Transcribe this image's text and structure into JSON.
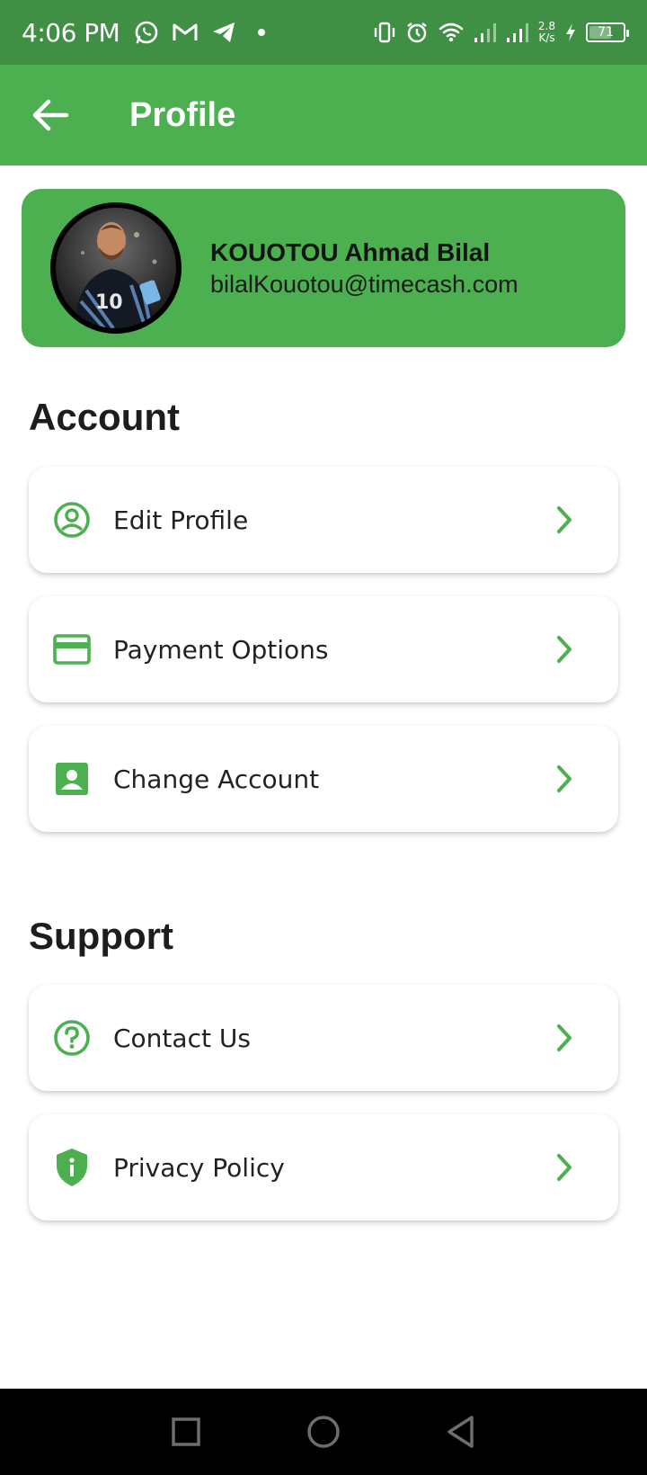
{
  "status_bar": {
    "time": "4:06 PM",
    "speed_value": "2.8",
    "speed_unit": "K/s",
    "battery": "71",
    "battery_level": 0.71,
    "icons": [
      "whatsapp-icon",
      "gmail-icon",
      "telegram-icon",
      "notification-dot",
      "vibrate-icon",
      "alarm-icon",
      "wifi-icon",
      "signal-icon",
      "signal-icon",
      "charging-icon",
      "battery-icon"
    ]
  },
  "app_bar": {
    "title": "Profile",
    "back_icon": "arrow-left-icon"
  },
  "profile": {
    "name": "KOUOTOU Ahmad Bilal",
    "email": "bilalKouotou@timecash.com"
  },
  "account": {
    "title": "Account",
    "items": [
      {
        "label": "Edit Profile",
        "icon": "account-circle-icon"
      },
      {
        "label": "Payment Options",
        "icon": "credit-card-icon"
      },
      {
        "label": "Change Account",
        "icon": "account-box-icon"
      }
    ]
  },
  "support": {
    "title": "Support",
    "items": [
      {
        "label": "Contact Us",
        "icon": "help-circle-icon"
      },
      {
        "label": "Privacy Policy",
        "icon": "shield-info-icon"
      }
    ]
  },
  "nav_bar": {
    "icons": [
      "recents-square-icon",
      "home-circle-icon",
      "back-triangle-icon"
    ]
  },
  "colors": {
    "primary": "#4caf50",
    "status_bar": "#3f8f44",
    "icon_green": "#4caf50",
    "text_dark": "#1f1f1f"
  }
}
